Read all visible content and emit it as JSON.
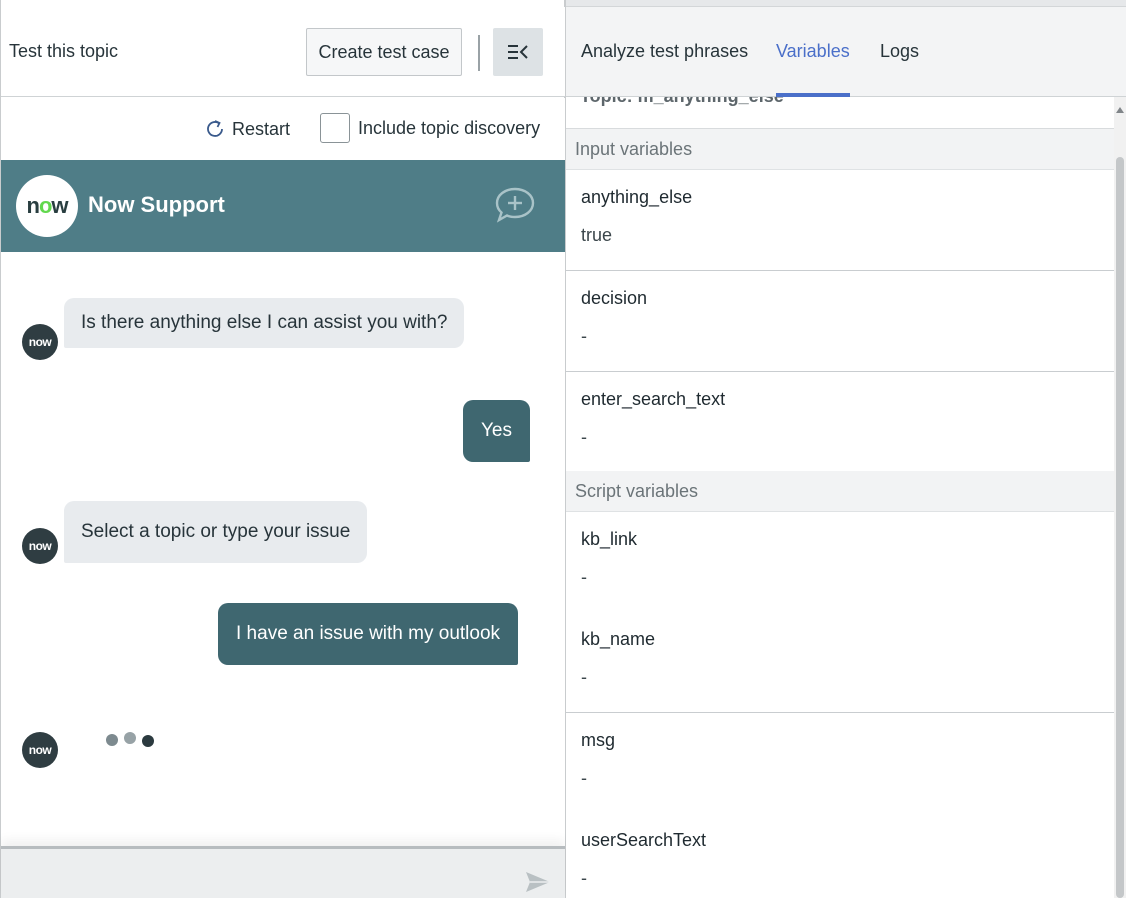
{
  "left": {
    "title": "Test this topic",
    "create_test_case": "Create test case",
    "collapse_icon": "collapse-panel-icon",
    "restart_label": "Restart",
    "restart_icon": "refresh-icon",
    "include_discovery_label": "Include topic discovery",
    "include_discovery_checked": false
  },
  "chat": {
    "title": "Now Support",
    "logo": {
      "n": "n",
      "o": "o",
      "w": "w"
    },
    "avatar_text": "now",
    "new_chat_icon": "chat-plus-icon",
    "messages": [
      {
        "from": "bot",
        "text": "Is there anything else I can assist you with?"
      },
      {
        "from": "user",
        "text": "Yes"
      },
      {
        "from": "bot",
        "text": "Select a topic or type your issue"
      },
      {
        "from": "user",
        "text": "I have an issue with my outlook"
      }
    ],
    "typing_indicator": true,
    "composer_placeholder": "",
    "send_icon": "send-icon"
  },
  "right": {
    "tabs": [
      {
        "label": "Analyze test phrases",
        "active": false
      },
      {
        "label": "Variables",
        "active": true
      },
      {
        "label": "Logs",
        "active": false
      }
    ],
    "topic_line": "Topic: m_anything_else",
    "sections": [
      {
        "label": "Input variables",
        "variables": [
          {
            "name": "anything_else",
            "value": "true"
          },
          {
            "name": "decision",
            "value": "-"
          },
          {
            "name": "enter_search_text",
            "value": "-"
          }
        ]
      },
      {
        "label": "Script variables",
        "variables": [
          {
            "name": "kb_link",
            "value": "-"
          },
          {
            "name": "kb_name",
            "value": "-"
          },
          {
            "name": "msg",
            "value": "-"
          },
          {
            "name": "userSearchText",
            "value": "-"
          }
        ]
      }
    ]
  },
  "colors": {
    "chat_header": "#4f7d87",
    "user_bubble": "#3f6770",
    "bot_bubble": "#e8ebee",
    "active_tab": "#4a6fc9",
    "logo_o": "#62d84e"
  }
}
